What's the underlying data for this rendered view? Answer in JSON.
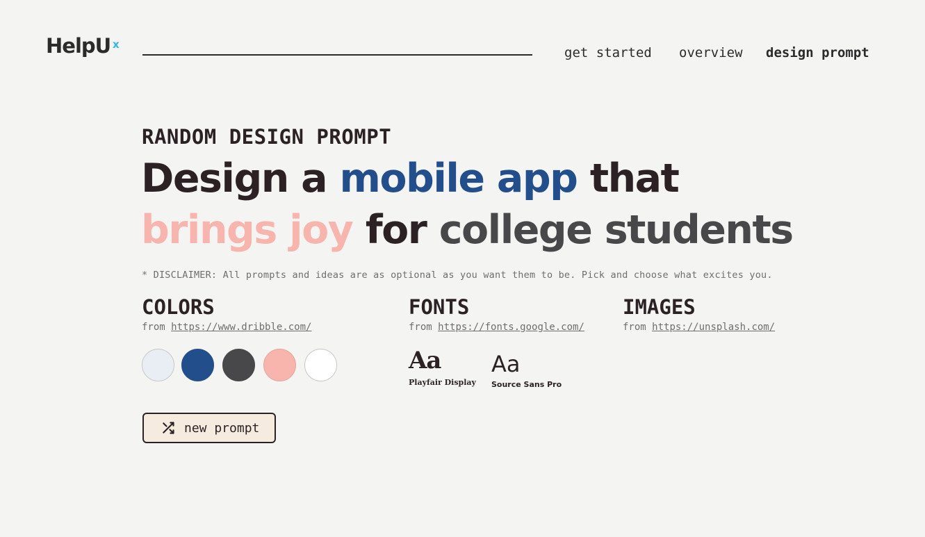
{
  "header": {
    "logo_text": "HelpU",
    "logo_superscript": "x",
    "nav": [
      {
        "label": "get started"
      },
      {
        "label": "overview"
      },
      {
        "label": "design prompt"
      }
    ]
  },
  "prompt": {
    "eyebrow": "RANDOM DESIGN PROMPT",
    "headline": {
      "part_1": "Design a ",
      "part_2": "mobile app",
      "part_3": " that",
      "part_4": "brings joy",
      "part_5": " for ",
      "part_6": "college students"
    },
    "disclaimer": "* DISCLAIMER: All prompts and ideas are as optional as you want them to be. Pick and choose what excites you."
  },
  "colors": {
    "title": "COLORS",
    "from_label": "from",
    "source": "https://www.dribble.com/",
    "swatches": [
      "#e9eef5",
      "#234e8c",
      "#48484b",
      "#f7b5ae",
      "#ffffff"
    ]
  },
  "fonts": {
    "title": "FONTS",
    "from_label": "from",
    "source": "https://fonts.google.com/",
    "items": [
      {
        "sample": "Aa",
        "name": "Playfair Display"
      },
      {
        "sample": "Aa",
        "name": "Source Sans Pro"
      }
    ]
  },
  "images": {
    "title": "IMAGES",
    "from_label": "from",
    "source": "https://unsplash.com/"
  },
  "actions": {
    "new_prompt_label": "new prompt",
    "new_prompt_icon": "shuffle-icon"
  },
  "theme": {
    "background": "#f4f4f2",
    "text_dark": "#2c2226",
    "accent_blue": "#234e8c",
    "accent_pink": "#f7b5ae",
    "accent_gray": "#48484b",
    "logo_accent": "#36b7e6",
    "button_bg": "#f5ecdf"
  }
}
